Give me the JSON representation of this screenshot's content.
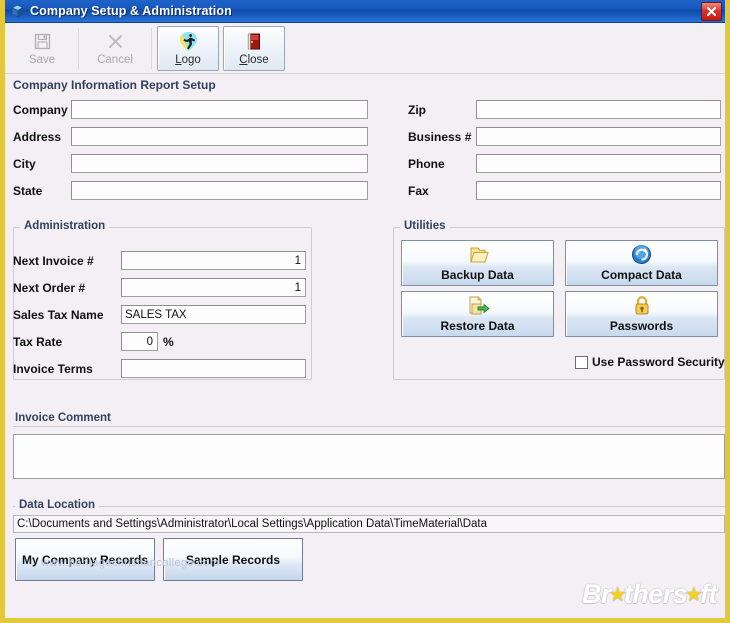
{
  "window": {
    "title": "Company Setup & Administration",
    "app_icon": "cube-icon",
    "close_icon": "close-icon",
    "border_color": "#e3c83c",
    "titlebar_color": "#1456bd"
  },
  "toolbar": {
    "buttons": [
      {
        "label": "Save",
        "accel": "S",
        "icon": "save-disk-icon",
        "state": "disabled"
      },
      {
        "label": "Cancel",
        "accel": "C",
        "icon": "cancel-x-icon",
        "state": "disabled"
      },
      {
        "label": "Logo",
        "accel": "L",
        "icon": "logo-runner-icon",
        "state": "enabled"
      },
      {
        "label": "Close",
        "accel": "C",
        "icon": "close-door-icon",
        "state": "enabled"
      }
    ]
  },
  "report_setup": {
    "title": "Company Information Report Setup",
    "left_fields": [
      {
        "label": "Company",
        "value": "",
        "placeholder": ""
      },
      {
        "label": "Address",
        "value": "",
        "placeholder": ""
      },
      {
        "label": "City",
        "value": "",
        "placeholder": ""
      },
      {
        "label": "State",
        "value": "",
        "placeholder": ""
      }
    ],
    "right_fields": [
      {
        "label": "Zip",
        "value": "",
        "placeholder": ""
      },
      {
        "label": "Business #",
        "value": "",
        "placeholder": ""
      },
      {
        "label": "Phone",
        "value": "",
        "placeholder": ""
      },
      {
        "label": "Fax",
        "value": "",
        "placeholder": ""
      }
    ]
  },
  "administration": {
    "legend": "Administration",
    "fields": [
      {
        "label": "Next Invoice #",
        "value": "1",
        "align": "right"
      },
      {
        "label": "Next Order #",
        "value": "1",
        "align": "right"
      },
      {
        "label": "Sales Tax Name",
        "value": "SALES TAX",
        "align": "left"
      },
      {
        "label": "Tax Rate",
        "value": "0",
        "align": "right",
        "suffix": "%"
      },
      {
        "label": "Invoice Terms",
        "value": "",
        "align": "left"
      }
    ]
  },
  "utilities": {
    "legend": "Utilities",
    "buttons": [
      {
        "label": "Backup Data",
        "icon": "folder-icon"
      },
      {
        "label": "Compact Data",
        "icon": "refresh-circle-icon"
      },
      {
        "label": "Restore Data",
        "icon": "document-arrow-icon"
      },
      {
        "label": "Passwords",
        "icon": "padlock-icon"
      }
    ],
    "checkbox": {
      "label": "Use Password Security",
      "checked": false
    }
  },
  "invoice_comment": {
    "legend": "Invoice Comment",
    "value": "",
    "placeholder": ""
  },
  "data_location": {
    "legend": "Data Location",
    "path": "C:\\Documents and Settings\\Administrator\\Local Settings\\Application Data\\TimeMaterial\\Data",
    "buttons": [
      {
        "label": "My Company Records"
      },
      {
        "label": "Sample Records"
      }
    ]
  },
  "watermarks": {
    "url": "www.heritagechristiancollege.com",
    "brand_part1": "Br",
    "brand_part2": "thers",
    "brand_part3": "ft"
  }
}
